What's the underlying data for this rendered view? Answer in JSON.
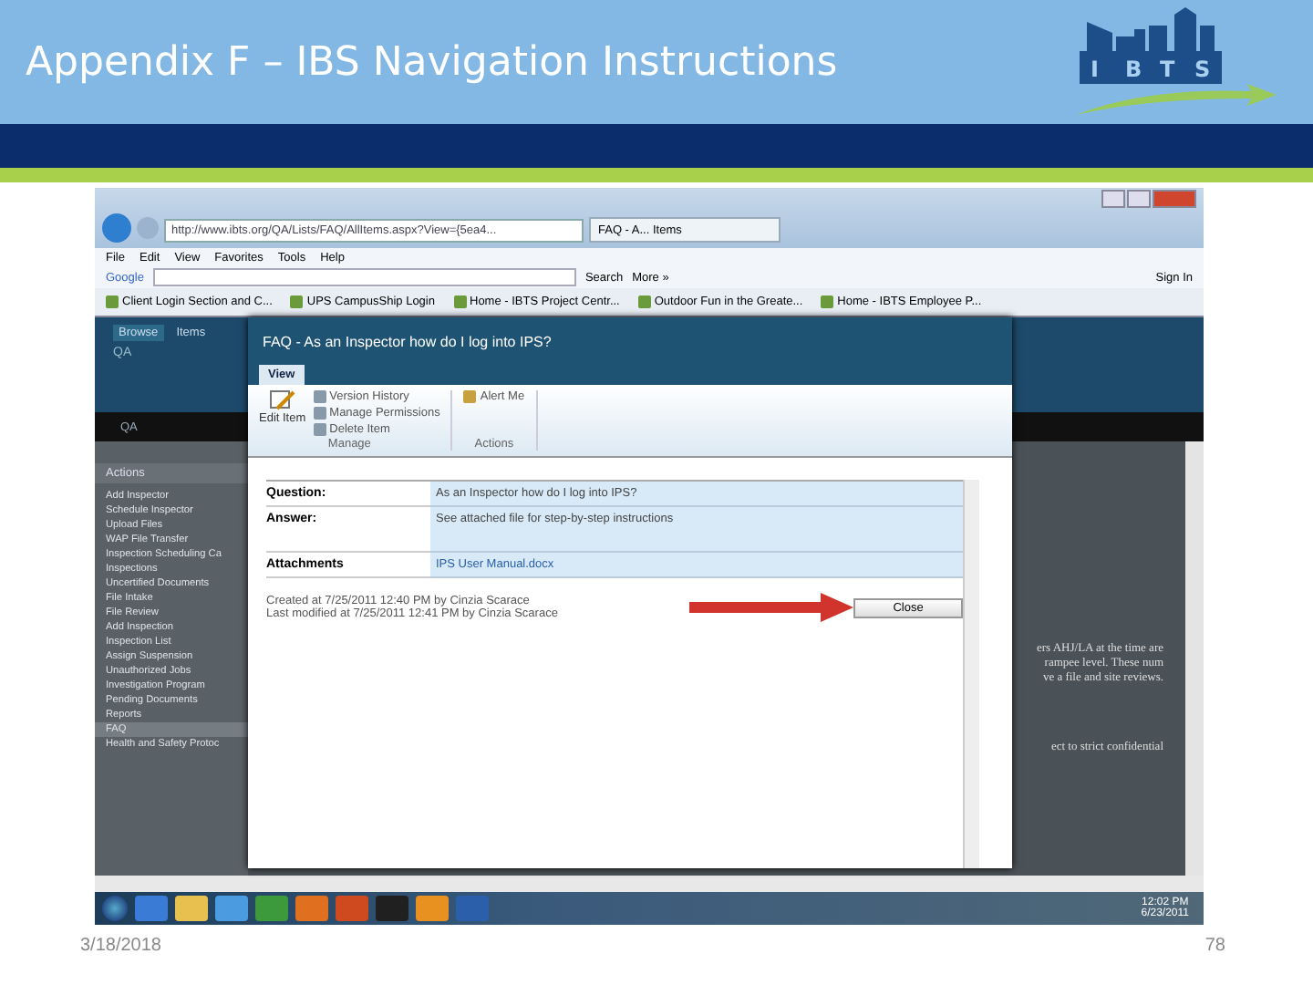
{
  "slide": {
    "title": "Appendix F – IBS Navigation Instructions",
    "logo_letters": [
      "I",
      "B",
      "T",
      "S"
    ],
    "date": "3/18/2018",
    "page_number": "78"
  },
  "browser": {
    "address": "http://www.ibts.org/QA/Lists/FAQ/AllItems.aspx?View={5ea4...",
    "tab": "FAQ - A... Items",
    "menu": [
      "File",
      "Edit",
      "View",
      "Favorites",
      "Tools",
      "Help"
    ],
    "toolbar": {
      "brand": "Google",
      "search": "Search",
      "more": "More »",
      "sign_in": "Sign In"
    },
    "favorites": [
      "Client Login Section and C...",
      "UPS CampusShip Login",
      "Home - IBTS Project Centr...",
      "Outdoor Fun in the Greate...",
      "Home - IBTS Employee P..."
    ]
  },
  "page": {
    "tabs": [
      {
        "label": "Browse",
        "selected": true
      },
      {
        "label": "Items",
        "selected": false
      }
    ],
    "site": "QA",
    "nav": "QA",
    "sidebar_heading": "Actions",
    "sidebar": [
      {
        "label": "Add Inspector",
        "selected": false
      },
      {
        "label": "Schedule Inspector",
        "selected": false
      },
      {
        "label": "Upload Files",
        "selected": false
      },
      {
        "label": "WAP File Transfer",
        "selected": false
      },
      {
        "label": "Inspection Scheduling Ca",
        "selected": false
      },
      {
        "label": "Inspections",
        "selected": false
      },
      {
        "label": "Uncertified Documents",
        "selected": false
      },
      {
        "label": "File Intake",
        "selected": false
      },
      {
        "label": "File Review",
        "selected": false
      },
      {
        "label": "Add Inspection",
        "selected": false
      },
      {
        "label": "Inspection List",
        "selected": false
      },
      {
        "label": "Assign Suspension",
        "selected": false
      },
      {
        "label": "Unauthorized Jobs",
        "selected": false
      },
      {
        "label": "Investigation Program",
        "selected": false
      },
      {
        "label": "Pending Documents",
        "selected": false
      },
      {
        "label": "Reports",
        "selected": false
      },
      {
        "label": "FAQ",
        "selected": true
      },
      {
        "label": "Health and Safety Protoc",
        "selected": false
      }
    ],
    "text_lines": [
      "ers AHJ/LA at the time are",
      "rampee level.  These num",
      "ve a file and site reviews.",
      "ect to strict confidential"
    ]
  },
  "dialog": {
    "title": "FAQ - As an Inspector how do I log into IPS?",
    "tabs": [
      {
        "label": "View",
        "selected": true
      }
    ],
    "ribbon": {
      "edit": "Edit Item",
      "items": [
        "Version History",
        "Manage Permissions",
        "Delete Item"
      ],
      "group_manage": "Manage",
      "alert": "Alert Me",
      "group_actions": "Actions"
    },
    "fields": [
      {
        "label": "Question:",
        "value": "As an Inspector how do I log into IPS?",
        "kind": "text"
      },
      {
        "label": "Answer:",
        "value": "See attached file for step-by-step instructions",
        "kind": "text"
      },
      {
        "label": "Attachments",
        "value": "IPS User Manual.docx",
        "kind": "link"
      }
    ],
    "created": "Created at 7/25/2011 12:40 PM by Cinzia Scarace",
    "modified": "Last modified at 7/25/2011 12:41 PM by Cinzia Scarace",
    "close": "Close"
  },
  "taskbar": {
    "time": "12:02 PM",
    "date": "6/23/2011"
  }
}
